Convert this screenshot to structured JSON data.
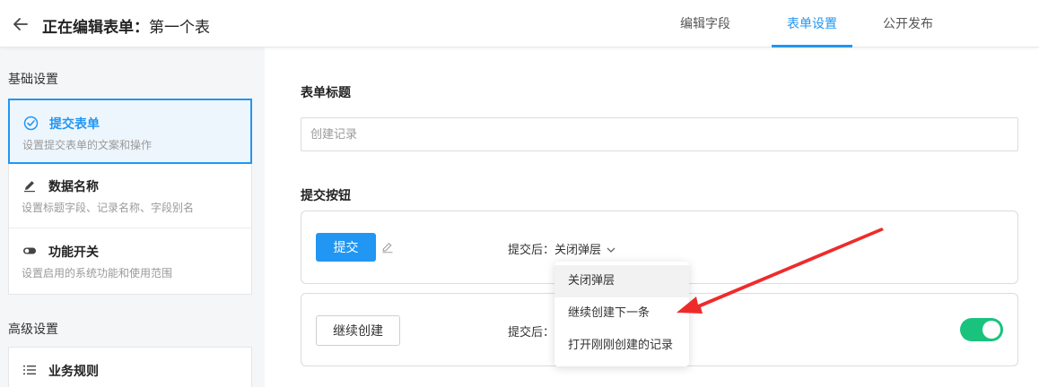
{
  "header": {
    "title_prefix": "正在编辑表单：",
    "title_name": "第一个表",
    "tabs": [
      {
        "label": "编辑字段",
        "active": false
      },
      {
        "label": "表单设置",
        "active": true
      },
      {
        "label": "公开发布",
        "active": false
      }
    ]
  },
  "sidebar": {
    "basic_title": "基础设置",
    "basic_items": [
      {
        "label": "提交表单",
        "desc": "设置提交表单的文案和操作",
        "icon": "check-circle-icon",
        "active": true
      },
      {
        "label": "数据名称",
        "desc": "设置标题字段、记录名称、字段别名",
        "icon": "pencil-icon",
        "active": false
      },
      {
        "label": "功能开关",
        "desc": "设置启用的系统功能和使用范围",
        "icon": "toggle-icon",
        "active": false
      }
    ],
    "advanced_title": "高级设置",
    "advanced_items": [
      {
        "label": "业务规则",
        "icon": "list-icon"
      }
    ]
  },
  "main": {
    "form_title_label": "表单标题",
    "form_title_placeholder": "创建记录",
    "submit_button_label": "提交按钮",
    "submit": {
      "button_label": "提交",
      "after_label": "提交后：",
      "after_value": "关闭弹层"
    },
    "continue": {
      "button_label": "继续创建",
      "after_label": "提交后：",
      "enabled": true
    },
    "dropdown_options": [
      "关闭弹层",
      "继续创建下一条",
      "打开刚刚创建的记录"
    ]
  },
  "colors": {
    "accent": "#2196f3",
    "toggle_on": "#19c37d",
    "annotation_arrow": "#ee2b2b"
  }
}
